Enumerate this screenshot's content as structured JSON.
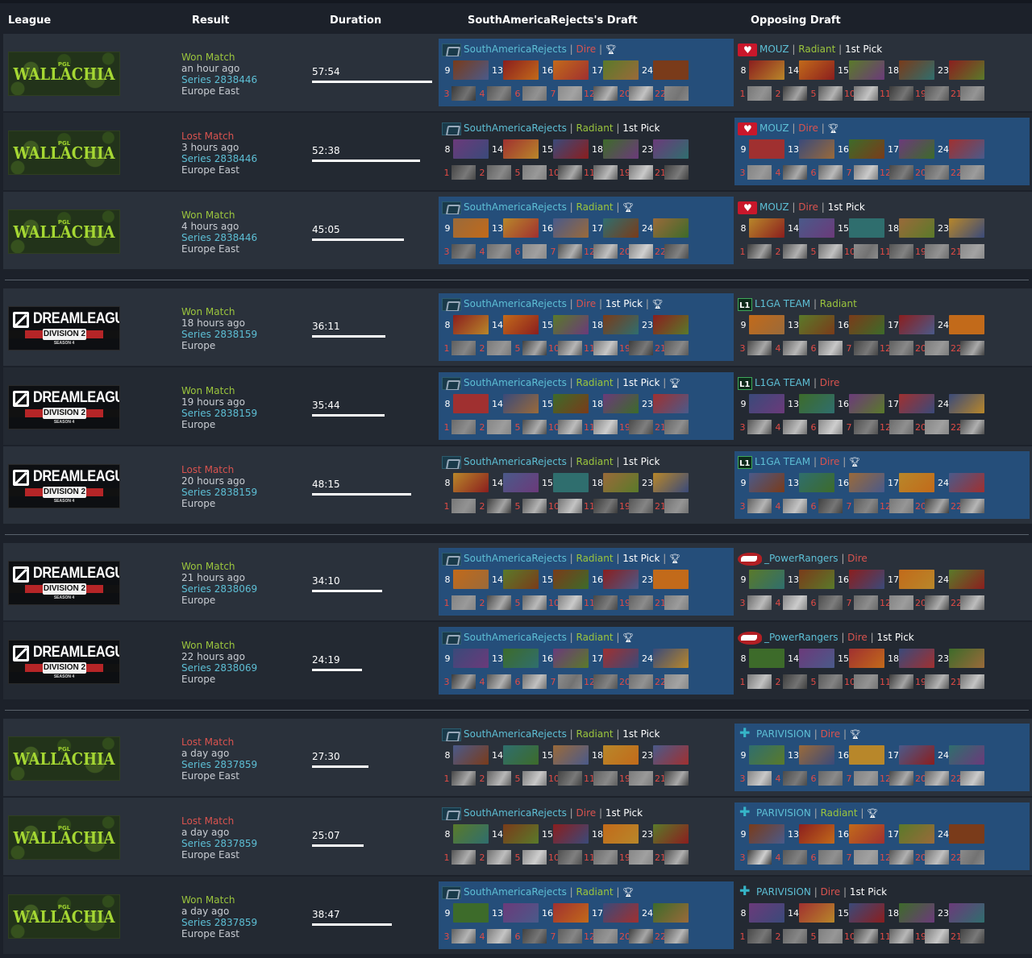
{
  "headers": {
    "league": "League",
    "result": "Result",
    "duration": "Duration",
    "team_draft": "SouthAmericaRejects's Draft",
    "opp_draft": "Opposing Draft"
  },
  "matches": [
    {
      "league": "PGL Wallachia",
      "result": "Won Match",
      "outcome": "won",
      "ago": "an hour ago",
      "series": "Series 2838446",
      "region": "Europe East",
      "duration": "57:54",
      "duration_fraction": 0.98,
      "our": {
        "team": "SouthAmericaRejects",
        "faction": "Dire",
        "first": "",
        "winner": true,
        "pick_nums": [
          "9",
          "13",
          "16",
          "17",
          "24"
        ],
        "ban_nums": [
          "3",
          "4",
          "6",
          "7",
          "12",
          "20",
          "22"
        ]
      },
      "opp": {
        "team": "MOUZ",
        "faction": "Radiant",
        "first": "1st Pick",
        "winner": false,
        "pick_nums": [
          "8",
          "14",
          "15",
          "18",
          "23"
        ],
        "ban_nums": [
          "1",
          "2",
          "5",
          "10",
          "11",
          "19",
          "21"
        ]
      }
    },
    {
      "league": "PGL Wallachia",
      "result": "Lost Match",
      "outcome": "lost",
      "ago": "3 hours ago",
      "series": "Series 2838446",
      "region": "Europe East",
      "duration": "52:38",
      "duration_fraction": 0.88,
      "our": {
        "team": "SouthAmericaRejects",
        "faction": "Radiant",
        "first": "1st Pick",
        "winner": false,
        "pick_nums": [
          "8",
          "14",
          "15",
          "18",
          "23"
        ],
        "ban_nums": [
          "1",
          "2",
          "5",
          "10",
          "11",
          "19",
          "21"
        ]
      },
      "opp": {
        "team": "MOUZ",
        "faction": "Dire",
        "first": "",
        "winner": true,
        "pick_nums": [
          "9",
          "13",
          "16",
          "17",
          "24"
        ],
        "ban_nums": [
          "3",
          "4",
          "6",
          "7",
          "12",
          "20",
          "22"
        ]
      }
    },
    {
      "league": "PGL Wallachia",
      "result": "Won Match",
      "outcome": "won",
      "ago": "4 hours ago",
      "series": "Series 2838446",
      "region": "Europe East",
      "duration": "45:05",
      "duration_fraction": 0.75,
      "our": {
        "team": "SouthAmericaRejects",
        "faction": "Radiant",
        "first": "",
        "winner": true,
        "pick_nums": [
          "9",
          "13",
          "16",
          "17",
          "24"
        ],
        "ban_nums": [
          "3",
          "4",
          "6",
          "7",
          "12",
          "20",
          "22"
        ]
      },
      "opp": {
        "team": "MOUZ",
        "faction": "Dire",
        "first": "1st Pick",
        "winner": false,
        "pick_nums": [
          "8",
          "14",
          "15",
          "18",
          "23"
        ],
        "ban_nums": [
          "1",
          "2",
          "5",
          "10",
          "11",
          "19",
          "21"
        ]
      }
    },
    {
      "league": "DreamLeague Division 2 Season 4",
      "result": "Won Match",
      "outcome": "won",
      "ago": "18 hours ago",
      "series": "Series 2838159",
      "region": "Europe",
      "duration": "36:11",
      "duration_fraction": 0.6,
      "our": {
        "team": "SouthAmericaRejects",
        "faction": "Dire",
        "first": "1st Pick",
        "winner": true,
        "pick_nums": [
          "8",
          "14",
          "15",
          "18",
          "23"
        ],
        "ban_nums": [
          "1",
          "2",
          "5",
          "10",
          "11",
          "19",
          "21"
        ]
      },
      "opp": {
        "team": "L1GA TEAM",
        "faction": "Radiant",
        "first": "",
        "winner": false,
        "pick_nums": [
          "9",
          "13",
          "16",
          "17",
          "24"
        ],
        "ban_nums": [
          "3",
          "4",
          "6",
          "7",
          "12",
          "20",
          "22"
        ]
      }
    },
    {
      "league": "DreamLeague Division 2 Season 4",
      "result": "Won Match",
      "outcome": "won",
      "ago": "19 hours ago",
      "series": "Series 2838159",
      "region": "Europe",
      "duration": "35:44",
      "duration_fraction": 0.59,
      "our": {
        "team": "SouthAmericaRejects",
        "faction": "Radiant",
        "first": "1st Pick",
        "winner": true,
        "pick_nums": [
          "8",
          "14",
          "15",
          "18",
          "23"
        ],
        "ban_nums": [
          "1",
          "2",
          "5",
          "10",
          "11",
          "19",
          "21"
        ]
      },
      "opp": {
        "team": "L1GA TEAM",
        "faction": "Dire",
        "first": "",
        "winner": false,
        "pick_nums": [
          "9",
          "13",
          "16",
          "17",
          "24"
        ],
        "ban_nums": [
          "3",
          "4",
          "6",
          "7",
          "12",
          "20",
          "22"
        ]
      }
    },
    {
      "league": "DreamLeague Division 2 Season 4",
      "result": "Lost Match",
      "outcome": "lost",
      "ago": "20 hours ago",
      "series": "Series 2838159",
      "region": "Europe",
      "duration": "48:15",
      "duration_fraction": 0.81,
      "our": {
        "team": "SouthAmericaRejects",
        "faction": "Radiant",
        "first": "1st Pick",
        "winner": false,
        "pick_nums": [
          "8",
          "14",
          "15",
          "18",
          "23"
        ],
        "ban_nums": [
          "1",
          "2",
          "5",
          "10",
          "11",
          "19",
          "21"
        ]
      },
      "opp": {
        "team": "L1GA TEAM",
        "faction": "Dire",
        "first": "",
        "winner": true,
        "pick_nums": [
          "9",
          "13",
          "16",
          "17",
          "24"
        ],
        "ban_nums": [
          "3",
          "4",
          "6",
          "7",
          "12",
          "20",
          "22"
        ]
      }
    },
    {
      "league": "DreamLeague Division 2 Season 4",
      "result": "Won Match",
      "outcome": "won",
      "ago": "21 hours ago",
      "series": "Series 2838069",
      "region": "Europe",
      "duration": "34:10",
      "duration_fraction": 0.57,
      "our": {
        "team": "SouthAmericaRejects",
        "faction": "Radiant",
        "first": "1st Pick",
        "winner": true,
        "pick_nums": [
          "8",
          "14",
          "15",
          "16",
          "23"
        ],
        "ban_nums": [
          "1",
          "2",
          "5",
          "10",
          "11",
          "19",
          "21"
        ]
      },
      "opp": {
        "team": "_PowerRangers",
        "faction": "Dire",
        "first": "",
        "winner": false,
        "pick_nums": [
          "9",
          "13",
          "16",
          "17",
          "24"
        ],
        "ban_nums": [
          "3",
          "4",
          "6",
          "7",
          "12",
          "20",
          "22"
        ]
      }
    },
    {
      "league": "DreamLeague Division 2 Season 4",
      "result": "Won Match",
      "outcome": "won",
      "ago": "22 hours ago",
      "series": "Series 2838069",
      "region": "Europe",
      "duration": "24:19",
      "duration_fraction": 0.41,
      "our": {
        "team": "SouthAmericaRejects",
        "faction": "Radiant",
        "first": "",
        "winner": true,
        "pick_nums": [
          "9",
          "13",
          "16",
          "17",
          "24"
        ],
        "ban_nums": [
          "3",
          "4",
          "6",
          "7",
          "12",
          "20",
          "22"
        ]
      },
      "opp": {
        "team": "_PowerRangers",
        "faction": "Dire",
        "first": "1st Pick",
        "winner": false,
        "pick_nums": [
          "8",
          "14",
          "15",
          "18",
          "23"
        ],
        "ban_nums": [
          "1",
          "2",
          "5",
          "10",
          "11",
          "19",
          "21"
        ]
      }
    },
    {
      "league": "PGL Wallachia",
      "result": "Lost Match",
      "outcome": "lost",
      "ago": "a day ago",
      "series": "Series 2837859",
      "region": "Europe East",
      "duration": "27:30",
      "duration_fraction": 0.46,
      "our": {
        "team": "SouthAmericaRejects",
        "faction": "Radiant",
        "first": "1st Pick",
        "winner": false,
        "pick_nums": [
          "8",
          "14",
          "15",
          "18",
          "23"
        ],
        "ban_nums": [
          "1",
          "2",
          "5",
          "10",
          "11",
          "19",
          "21"
        ]
      },
      "opp": {
        "team": "PARIVISION",
        "faction": "Dire",
        "first": "",
        "winner": true,
        "pick_nums": [
          "9",
          "13",
          "16",
          "17",
          "24"
        ],
        "ban_nums": [
          "3",
          "4",
          "6",
          "7",
          "12",
          "20",
          "22"
        ]
      }
    },
    {
      "league": "PGL Wallachia",
      "result": "Lost Match",
      "outcome": "lost",
      "ago": "a day ago",
      "series": "Series 2837859",
      "region": "Europe East",
      "duration": "25:07",
      "duration_fraction": 0.42,
      "our": {
        "team": "SouthAmericaRejects",
        "faction": "Dire",
        "first": "1st Pick",
        "winner": false,
        "pick_nums": [
          "8",
          "14",
          "15",
          "18",
          "23"
        ],
        "ban_nums": [
          "1",
          "2",
          "5",
          "10",
          "11",
          "19",
          "21"
        ]
      },
      "opp": {
        "team": "PARIVISION",
        "faction": "Radiant",
        "first": "",
        "winner": true,
        "pick_nums": [
          "9",
          "13",
          "16",
          "17",
          "24"
        ],
        "ban_nums": [
          "3",
          "4",
          "6",
          "7",
          "12",
          "20",
          "22"
        ]
      }
    },
    {
      "league": "PGL Wallachia",
      "result": "Won Match",
      "outcome": "won",
      "ago": "a day ago",
      "series": "Series 2837859",
      "region": "Europe East",
      "duration": "38:47",
      "duration_fraction": 0.65,
      "our": {
        "team": "SouthAmericaRejects",
        "faction": "Radiant",
        "first": "",
        "winner": true,
        "pick_nums": [
          "9",
          "13",
          "16",
          "17",
          "24"
        ],
        "ban_nums": [
          "3",
          "4",
          "6",
          "7",
          "12",
          "20",
          "22"
        ]
      },
      "opp": {
        "team": "PARIVISION",
        "faction": "Dire",
        "first": "1st Pick",
        "winner": false,
        "pick_nums": [
          "8",
          "14",
          "15",
          "18",
          "23"
        ],
        "ban_nums": [
          "1",
          "2",
          "5",
          "10",
          "11",
          "19",
          "21"
        ]
      }
    }
  ],
  "logo_text": {
    "pgl_small": "PGL",
    "pgl_big": "WALLACHIA",
    "dl_main": "DREAMLEAGUE",
    "dl_div": "DIVISION 2",
    "dl_season": "SEASON 4"
  },
  "colors": {
    "winner_panel": "#254e7a",
    "won": "#9bc53d",
    "lost": "#d9534f",
    "link": "#5dbfd5",
    "dire": "#d9534f",
    "radiant": "#9bc53d"
  }
}
